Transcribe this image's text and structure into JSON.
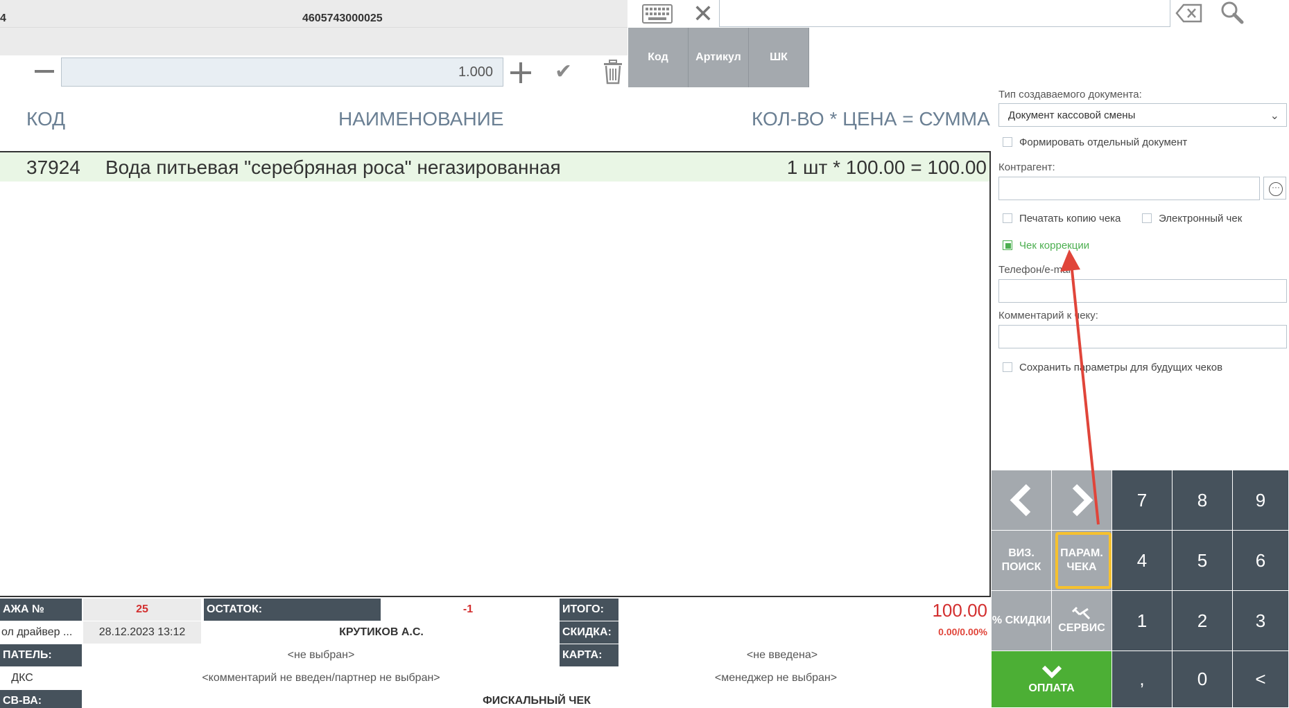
{
  "top": {
    "row1_col1": "4",
    "row1_col2": "4605743000025",
    "quantity_value": "1.000"
  },
  "search": {
    "value": ""
  },
  "mode_tabs": [
    "Код",
    "Артикул",
    "ШК"
  ],
  "list": {
    "headers": {
      "code": "КОД",
      "name": "НАИМЕНОВАНИЕ",
      "qty": "КОЛ-ВО * ЦЕНА = СУММА"
    },
    "rows": [
      {
        "code": "37924",
        "name": "Вода питьевая \"серебряная роса\" негазированная",
        "qty_price_sum": "1 шт * 100.00 = 100.00"
      }
    ]
  },
  "footer": {
    "sale_label": "АЖА №",
    "sale_number": "25",
    "remainder_label": "ОСТАТОК:",
    "remainder_value": "-1",
    "total_label": "ИТОГО:",
    "total_value": "100.00",
    "driver_label": "ол драйвер ...",
    "datetime": "28.12.2023 13:12",
    "cashier": "КРУТИКОВ А.С.",
    "discount_label": "СКИДКА:",
    "discount_value": "0.00/0.00%",
    "buyer_label": "ПАТЕЛЬ:",
    "buyer_value": "<не выбран>",
    "card_label": "КАРТА:",
    "card_value": "<не введена>",
    "dks_label": "ДКС",
    "comment_value": "<комментарий не введен/партнер не выбран>",
    "manager_value": "<менеджер не выбран>",
    "props_label": "СВ-ВА:",
    "receipt_type": "ФИСКАЛЬНЫЙ ЧЕК"
  },
  "right_panel": {
    "doc_type_label": "Тип создаваемого документа:",
    "doc_type_value": "Документ кассовой смены",
    "separate_doc": "Формировать отдельный документ",
    "counterparty_label": "Контрагент:",
    "print_copy": "Печатать копию чека",
    "electronic": "Электронный чек",
    "correction": "Чек коррекции",
    "phone_label": "Телефон/e-mail",
    "comment_label": "Комментарий к чеку:",
    "save_params": "Сохранить параметры для будущих чеков"
  },
  "keypad": {
    "viz_search": "ВИЗ. ПОИСК",
    "params": "ПАРАМ. ЧЕКА",
    "discounts": "% СКИДКИ",
    "service": "СЕРВИС",
    "pay": "ОПЛАТА",
    "digits": [
      "7",
      "8",
      "9",
      "4",
      "5",
      "6",
      "1",
      "2",
      "3",
      ",",
      "0",
      "<"
    ]
  },
  "colors": {
    "panel_dark": "#46525c",
    "panel_light": "#a4a9ae",
    "pay_green": "#4caf35",
    "highlight": "#f6c12e",
    "annotation_arrow": "#e0453a",
    "selected_row": "#e9f6e5"
  }
}
